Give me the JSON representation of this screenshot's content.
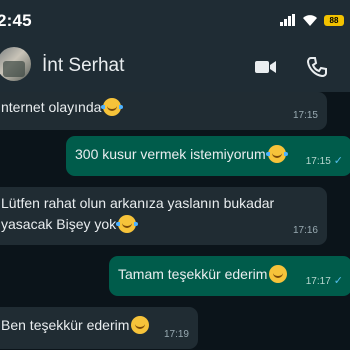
{
  "status_bar": {
    "time": "2:45",
    "battery": "88"
  },
  "header": {
    "contact_name": "İnt Serhat"
  },
  "messages": [
    {
      "direction": "in",
      "text": "nternet olayında",
      "emoji": "tears",
      "time": "17:15"
    },
    {
      "direction": "out",
      "text": "300 kusur vermek istemiyorum",
      "emoji": "tears",
      "time": "17:15",
      "read": true
    },
    {
      "direction": "in",
      "line1": "Lütfen rahat olun arkanıza yaslanın bukadar",
      "line2": "yasacak Bişey yok",
      "emoji": "tears",
      "time": "17:16"
    },
    {
      "direction": "out",
      "text": "Tamam teşekkür ederim",
      "emoji": "smile",
      "time": "17:17",
      "read": true
    },
    {
      "direction": "in",
      "text": "Ben teşekkür ederim",
      "emoji": "smile",
      "time": "17:19"
    }
  ],
  "colors": {
    "incoming": "#202c33",
    "outgoing": "#005c4b",
    "background": "#0b141a",
    "header": "#1f2c34",
    "read_tick": "#53bdeb"
  }
}
